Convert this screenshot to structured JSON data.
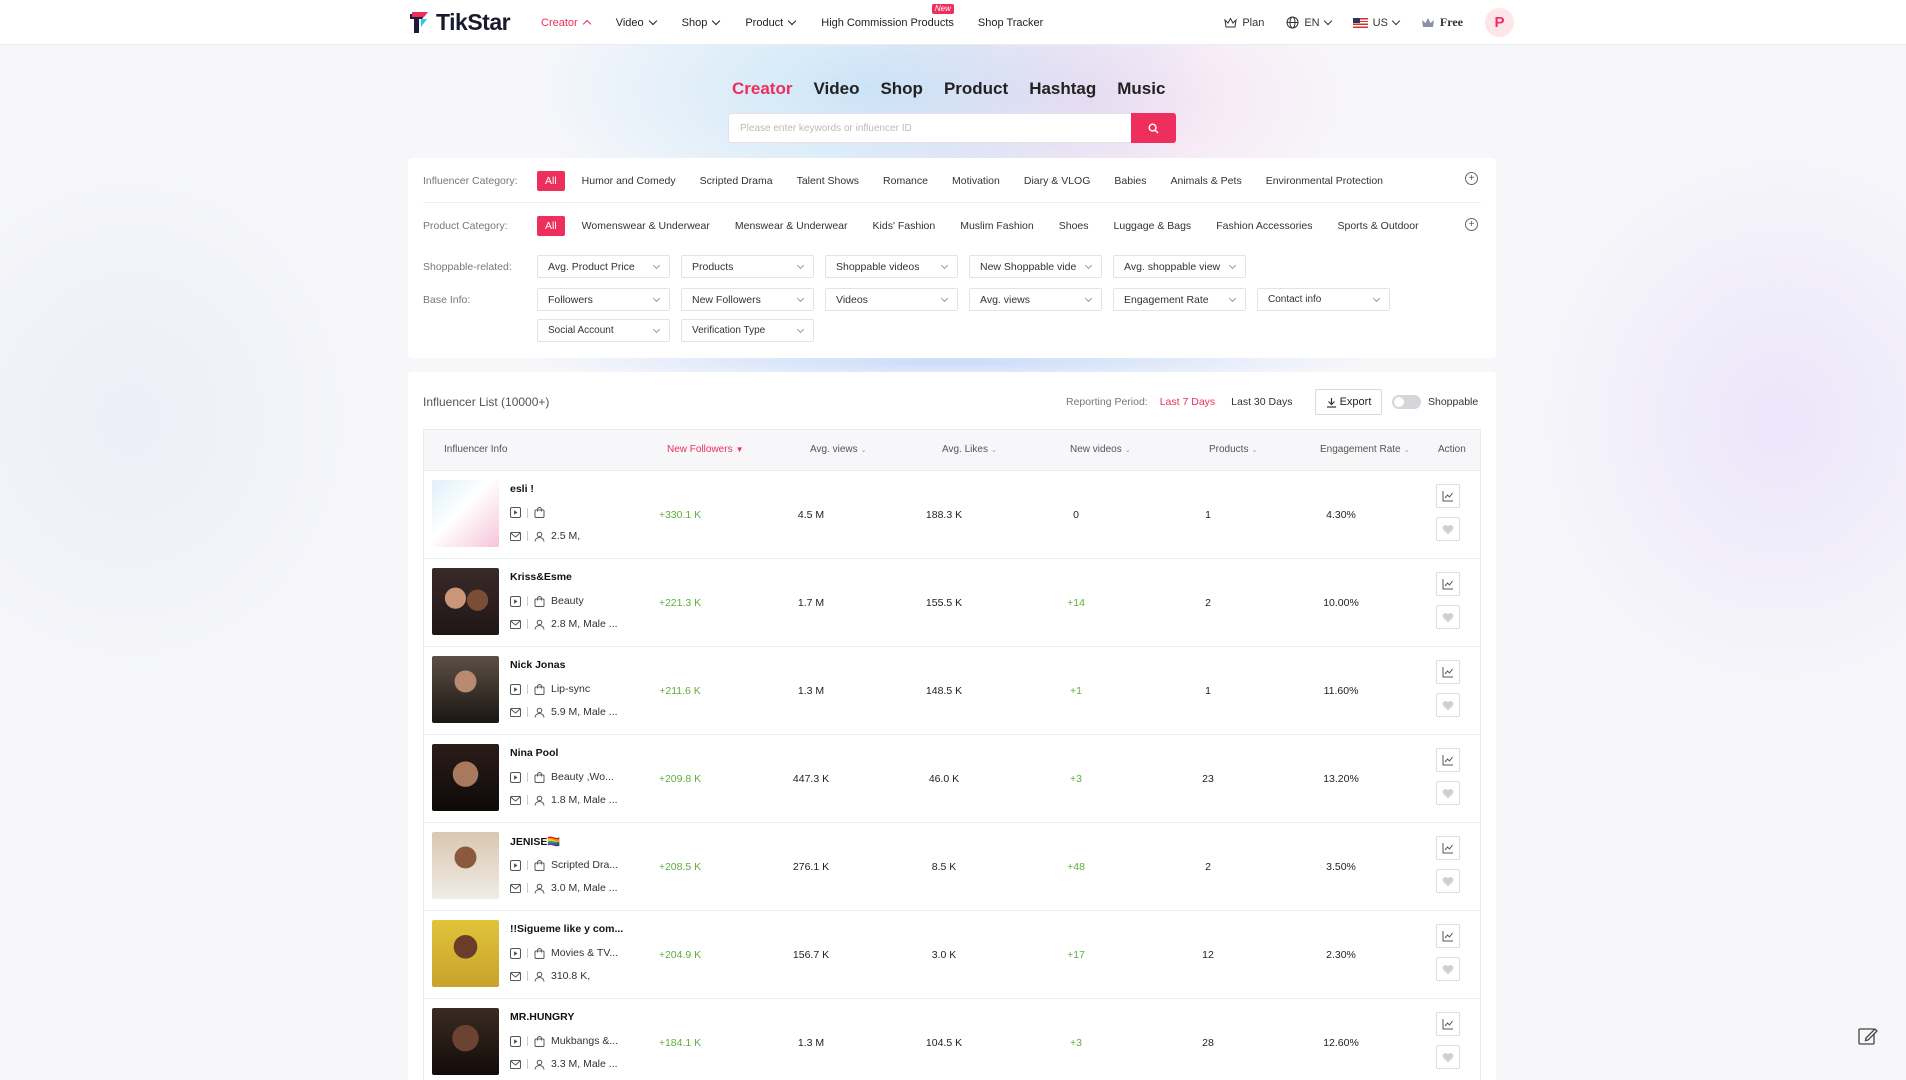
{
  "header": {
    "logo_text": "TikStar",
    "nav": [
      {
        "label": "Creator",
        "active": true,
        "dropdown": "up"
      },
      {
        "label": "Video",
        "dropdown": "down"
      },
      {
        "label": "Shop",
        "dropdown": "down"
      },
      {
        "label": "Product",
        "dropdown": "down"
      },
      {
        "label": "High Commission Products",
        "badge": "New"
      },
      {
        "label": "Shop Tracker"
      }
    ],
    "plan_label": "Plan",
    "language": "EN",
    "region": "US",
    "tier": "Free",
    "avatar_letter": "P"
  },
  "search": {
    "tabs": [
      "Creator",
      "Video",
      "Shop",
      "Product",
      "Hashtag",
      "Music"
    ],
    "active_tab": "Creator",
    "placeholder": "Please enter keywords or influencer ID",
    "value": ""
  },
  "filters": {
    "influencer_category_label": "Influencer Category:",
    "influencer_categories": [
      "All",
      "Humor and Comedy",
      "Scripted Drama",
      "Talent Shows",
      "Romance",
      "Motivation",
      "Diary & VLOG",
      "Babies",
      "Animals & Pets",
      "Environmental Protection"
    ],
    "product_category_label": "Product Category:",
    "product_categories": [
      "All",
      "Womenswear & Underwear",
      "Menswear & Underwear",
      "Kids' Fashion",
      "Muslim Fashion",
      "Shoes",
      "Luggage & Bags",
      "Fashion Accessories",
      "Sports & Outdoor"
    ],
    "shoppable_label": "Shoppable-related:",
    "shoppable_dropdowns": [
      "Avg. Product Price",
      "Products",
      "Shoppable videos",
      "New Shoppable vide",
      "Avg. shoppable view"
    ],
    "base_info_label": "Base Info:",
    "base_info_dropdowns": [
      "Followers",
      "New Followers",
      "Videos",
      "Avg. views",
      "Engagement Rate",
      "Contact info"
    ],
    "base_info_dropdowns_2": [
      "Social Account",
      "Verification Type"
    ]
  },
  "list": {
    "title": "Influencer List (10000+)",
    "reporting_period_label": "Reporting Period:",
    "period_options": [
      "Last 7 Days",
      "Last 30 Days"
    ],
    "active_period": "Last 7 Days",
    "export_label": "Export",
    "shoppable_toggle_label": "Shoppable",
    "shoppable_on": false,
    "columns": [
      "Influencer Info",
      "New Followers",
      "Avg. views",
      "Avg. Likes",
      "New videos",
      "Products",
      "Engagement Rate",
      "Action"
    ],
    "sorted_column": "New Followers",
    "rows": [
      {
        "name": "esli !",
        "category": "",
        "meta": "2.5 M,",
        "new_followers": "+330.1 K",
        "avg_views": "4.5 M",
        "avg_likes": "188.3 K",
        "new_videos": "0",
        "products": "1",
        "engagement": "4.30%"
      },
      {
        "name": "Kriss&Esme",
        "category": "Beauty",
        "meta": "2.8 M, Male ...",
        "new_followers": "+221.3 K",
        "avg_views": "1.7 M",
        "avg_likes": "155.5 K",
        "new_videos": "+14",
        "products": "2",
        "engagement": "10.00%"
      },
      {
        "name": "Nick Jonas",
        "category": "Lip-sync",
        "meta": "5.9 M, Male ...",
        "new_followers": "+211.6 K",
        "avg_views": "1.3 M",
        "avg_likes": "148.5 K",
        "new_videos": "+1",
        "products": "1",
        "engagement": "11.60%"
      },
      {
        "name": "Nina Pool",
        "category": "Beauty ,Wo...",
        "meta": "1.8 M, Male ...",
        "new_followers": "+209.8 K",
        "avg_views": "447.3 K",
        "avg_likes": "46.0 K",
        "new_videos": "+3",
        "products": "23",
        "engagement": "13.20%"
      },
      {
        "name": "JENISE🏳️‍🌈",
        "category": "Scripted Dra...",
        "meta": "3.0 M, Male ...",
        "new_followers": "+208.5 K",
        "avg_views": "276.1 K",
        "avg_likes": "8.5 K",
        "new_videos": "+48",
        "products": "2",
        "engagement": "3.50%"
      },
      {
        "name": "!!Sigueme like y com...",
        "category": "Movies & TV...",
        "meta": "310.8 K,",
        "new_followers": "+204.9 K",
        "avg_views": "156.7 K",
        "avg_likes": "3.0 K",
        "new_videos": "+17",
        "products": "12",
        "engagement": "2.30%"
      },
      {
        "name": "MR.HUNGRY",
        "category": "Mukbangs &...",
        "meta": "3.3 M, Male ...",
        "new_followers": "+184.1 K",
        "avg_views": "1.3 M",
        "avg_likes": "104.5 K",
        "new_videos": "+3",
        "products": "28",
        "engagement": "12.60%"
      }
    ]
  },
  "colors": {
    "accent": "#ee2e5c",
    "positive": "#5dae3b"
  }
}
